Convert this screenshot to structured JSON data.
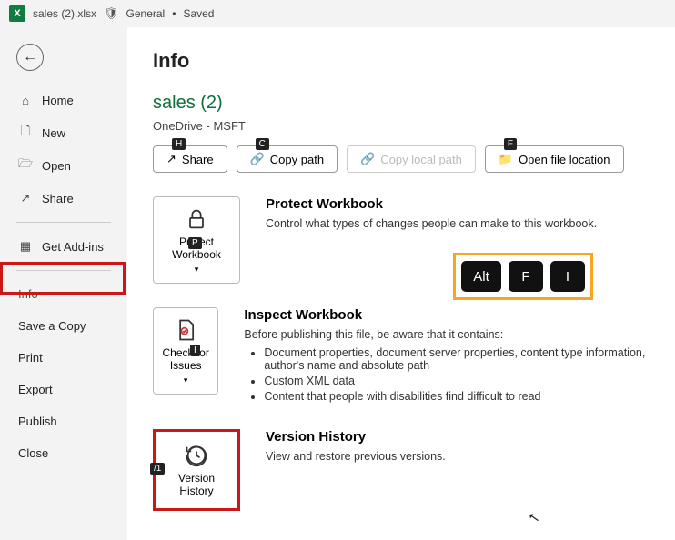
{
  "titlebar": {
    "filename": "sales (2).xlsx",
    "sensitivity": "General",
    "status": "Saved"
  },
  "sidebar": {
    "items": [
      {
        "label": "Home"
      },
      {
        "label": "New"
      },
      {
        "label": "Open"
      },
      {
        "label": "Share"
      },
      {
        "label": "Get Add-ins"
      },
      {
        "label": "Info"
      },
      {
        "label": "Save a Copy"
      },
      {
        "label": "Print"
      },
      {
        "label": "Export"
      },
      {
        "label": "Publish"
      },
      {
        "label": "Close"
      }
    ]
  },
  "page": {
    "title": "Info",
    "docname": "sales (2)",
    "location": "OneDrive - MSFT"
  },
  "actions": {
    "share": {
      "label": "Share",
      "key": "H"
    },
    "copypath": {
      "label": "Copy path",
      "key": "C"
    },
    "copylocal": {
      "label": "Copy local path"
    },
    "openloc": {
      "label": "Open file location",
      "key": "F"
    }
  },
  "protect": {
    "btn": "Protect Workbook",
    "btn_key": "P",
    "heading": "Protect Workbook",
    "desc": "Control what types of changes people can make to this workbook."
  },
  "inspect": {
    "btn": "Check for Issues",
    "btn_key": "I",
    "heading": "Inspect Workbook",
    "desc": "Before publishing this file, be aware that it contains:",
    "items": [
      "Document properties, document server properties, content type information, author's name and absolute path",
      "Custom XML data",
      "Content that people with disabilities find difficult to read"
    ]
  },
  "version": {
    "btn": "Version History",
    "btn_key": "/1",
    "heading": "Version History",
    "desc": "View and restore previous versions."
  },
  "keytips": {
    "k1": "Alt",
    "k2": "F",
    "k3": "I"
  }
}
